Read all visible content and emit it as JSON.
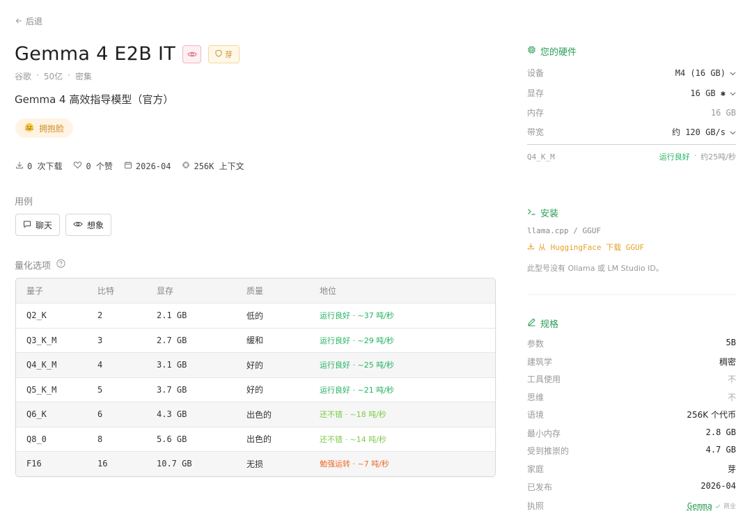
{
  "nav": {
    "back_label": "后退"
  },
  "model": {
    "title": "Gemma 4 E2B IT",
    "bud_badge": "芽",
    "meta": [
      "谷歌",
      "50亿",
      "密集"
    ],
    "meta_sep": "·",
    "description": "Gemma 4 高效指导模型（官方）",
    "source_pill": "拥抱脸",
    "stats": {
      "downloads": "0 次下载",
      "likes": "0 个赞",
      "date": "2026-04",
      "context": "256K 上下文"
    }
  },
  "use_cases": {
    "label": "用例",
    "items": [
      "聊天",
      "想象"
    ]
  },
  "quant": {
    "label": "量化选项",
    "headers": [
      "量子",
      "比特",
      "显存",
      "质量",
      "地位"
    ],
    "rows": [
      {
        "name": "Q2_K",
        "bits": "2",
        "vram": "2.1 GB",
        "quality": "低的",
        "status": "运行良好 · ~37 吨/秒",
        "level": "good"
      },
      {
        "name": "Q3_K_M",
        "bits": "3",
        "vram": "2.7 GB",
        "quality": "缓和",
        "status": "运行良好 · ~29 吨/秒",
        "level": "good"
      },
      {
        "name": "Q4_K_M",
        "bits": "4",
        "vram": "3.1 GB",
        "quality": "好的",
        "status": "运行良好 · ~25 吨/秒",
        "level": "good"
      },
      {
        "name": "Q5_K_M",
        "bits": "5",
        "vram": "3.7 GB",
        "quality": "好的",
        "status": "运行良好 · ~21 吨/秒",
        "level": "good"
      },
      {
        "name": "Q6_K",
        "bits": "6",
        "vram": "4.3 GB",
        "quality": "出色的",
        "status": "还不错 · ~18 吨/秒",
        "level": "ok"
      },
      {
        "name": "Q8_0",
        "bits": "8",
        "vram": "5.6 GB",
        "quality": "出色的",
        "status": "还不错 · ~14 吨/秒",
        "level": "ok"
      },
      {
        "name": "F16",
        "bits": "16",
        "vram": "10.7 GB",
        "quality": "无损",
        "status": "勉强运转 · ~7 吨/秒",
        "level": "bad"
      }
    ]
  },
  "hardware": {
    "title": "您的硬件",
    "rows": [
      {
        "label": "设备",
        "value": "M4 (16 GB)"
      },
      {
        "label": "显存",
        "value": "16 GB ✱"
      },
      {
        "label": "内存",
        "value": "16 GB"
      },
      {
        "label": "带宽",
        "value": "约 120 GB/s"
      }
    ],
    "summary_quant": "Q4_K_M",
    "summary_status": "运行良好",
    "summary_speed": "约25吨/秒",
    "summary_sep": "·"
  },
  "install": {
    "title": "安装",
    "format": "llama.cpp / GGUF",
    "download_link": "从 HuggingFace 下载 GGUF",
    "note": "此型号没有 Ollama 或 LM Studio ID。"
  },
  "specs": {
    "title": "规格",
    "rows": [
      {
        "label": "参数",
        "value": "5B"
      },
      {
        "label": "建筑学",
        "value": "稠密"
      },
      {
        "label": "工具使用",
        "value": "不"
      },
      {
        "label": "思维",
        "value": "不"
      },
      {
        "label": "语境",
        "value": "256K 个代币"
      },
      {
        "label": "最小内存",
        "value": "2.8 GB"
      },
      {
        "label": "受到推崇的",
        "value": "4.7 GB"
      },
      {
        "label": "家庭",
        "value": "芽"
      },
      {
        "label": "已发布",
        "value": "2026-04"
      }
    ],
    "license_label": "执照",
    "license_value": "Gemma",
    "license_tag": "商业"
  },
  "colors": {
    "accent_green": "#2a9d57",
    "status_good": "#22b362",
    "status_ok": "#7fc94a",
    "status_bad": "#ee6a2c",
    "link_orange": "#e5a12b"
  }
}
